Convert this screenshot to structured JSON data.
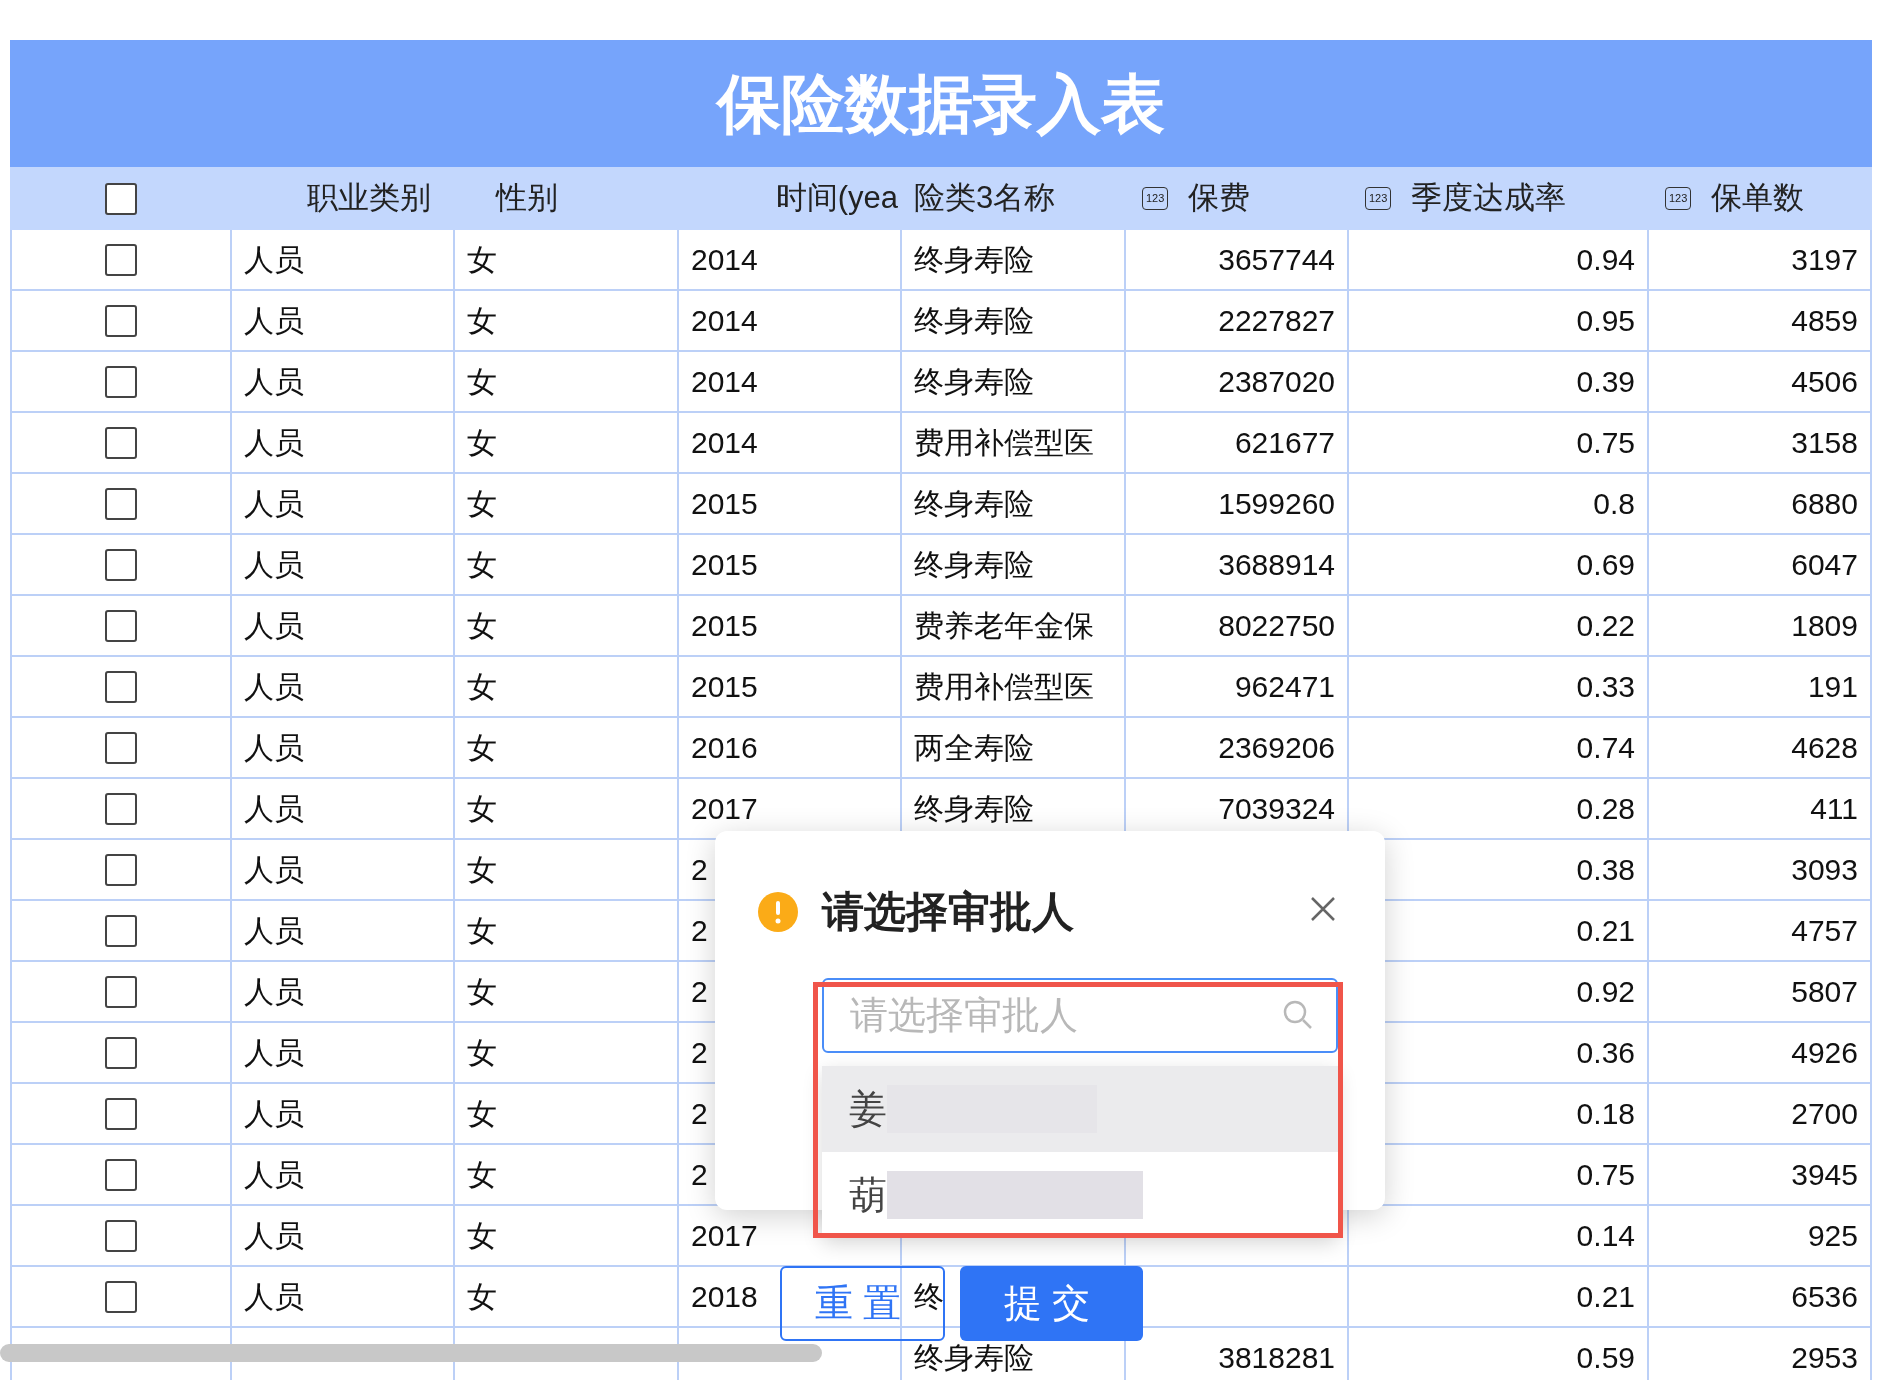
{
  "title": "保险数据录入表",
  "header": {
    "checked": false
  },
  "columns": [
    {
      "label": "职业类别",
      "kind": "text"
    },
    {
      "label": "性别",
      "kind": "text"
    },
    {
      "label": "时间(yea",
      "kind": "text"
    },
    {
      "label": "险类3名称",
      "kind": "text"
    },
    {
      "label": "保费",
      "kind": "number",
      "icon_text": "123"
    },
    {
      "label": "季度达成率",
      "kind": "number",
      "icon_text": "123"
    },
    {
      "label": "保单数",
      "kind": "number",
      "icon_text": "123"
    }
  ],
  "rows": [
    {
      "checked": false,
      "cells": [
        "人员",
        "女",
        "2014",
        "终身寿险",
        "3657744",
        "0.94",
        "3197"
      ]
    },
    {
      "checked": false,
      "cells": [
        "人员",
        "女",
        "2014",
        "终身寿险",
        "2227827",
        "0.95",
        "4859"
      ]
    },
    {
      "checked": false,
      "cells": [
        "人员",
        "女",
        "2014",
        "终身寿险",
        "2387020",
        "0.39",
        "4506"
      ]
    },
    {
      "checked": false,
      "cells": [
        "人员",
        "女",
        "2014",
        "费用补偿型医",
        "621677",
        "0.75",
        "3158"
      ]
    },
    {
      "checked": false,
      "cells": [
        "人员",
        "女",
        "2015",
        "终身寿险",
        "1599260",
        "0.8",
        "6880"
      ]
    },
    {
      "checked": false,
      "cells": [
        "人员",
        "女",
        "2015",
        "终身寿险",
        "3688914",
        "0.69",
        "6047"
      ]
    },
    {
      "checked": false,
      "cells": [
        "人员",
        "女",
        "2015",
        "费养老年金保",
        "8022750",
        "0.22",
        "1809"
      ]
    },
    {
      "checked": false,
      "cells": [
        "人员",
        "女",
        "2015",
        "费用补偿型医",
        "962471",
        "0.33",
        "191"
      ]
    },
    {
      "checked": false,
      "cells": [
        "人员",
        "女",
        "2016",
        "两全寿险",
        "2369206",
        "0.74",
        "4628"
      ]
    },
    {
      "checked": false,
      "cells": [
        "人员",
        "女",
        "2017",
        "终身寿险",
        "7039324",
        "0.28",
        "411"
      ]
    },
    {
      "checked": false,
      "cells": [
        "人员",
        "女",
        "2",
        null,
        null,
        "0.38",
        "3093"
      ]
    },
    {
      "checked": false,
      "cells": [
        "人员",
        "女",
        "2",
        null,
        null,
        "0.21",
        "4757"
      ]
    },
    {
      "checked": false,
      "cells": [
        "人员",
        "女",
        "2",
        null,
        null,
        "0.92",
        "5807"
      ]
    },
    {
      "checked": false,
      "cells": [
        "人员",
        "女",
        "2",
        null,
        null,
        "0.36",
        "4926"
      ]
    },
    {
      "checked": false,
      "cells": [
        "人员",
        "女",
        "2",
        null,
        null,
        "0.18",
        "2700"
      ]
    },
    {
      "checked": false,
      "cells": [
        "人员",
        "女",
        "2",
        null,
        null,
        "0.75",
        "3945"
      ]
    },
    {
      "checked": false,
      "cells": [
        "人员",
        "女",
        "2017",
        null,
        null,
        "0.14",
        "925"
      ]
    },
    {
      "checked": false,
      "cells": [
        "人员",
        "女",
        "2018",
        "终",
        null,
        "0.21",
        "6536"
      ]
    },
    {
      "cells": [
        null,
        null,
        null,
        "终身寿险",
        "3818281",
        "0.59",
        "2953"
      ]
    }
  ],
  "dialog": {
    "title": "请选择审批人",
    "search": {
      "placeholder": "请选择审批人"
    },
    "options": [
      {
        "text": "姜",
        "selected": true
      },
      {
        "text": "葫",
        "selected": false
      }
    ]
  },
  "buttons": [
    {
      "label": "重置",
      "kind": "outline"
    },
    {
      "label": "提交",
      "kind": "primary"
    }
  ]
}
